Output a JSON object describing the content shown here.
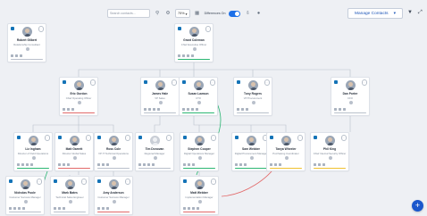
{
  "toolbar": {
    "search_placeholder": "Search contacts...",
    "zoom_value": "75%",
    "diff_label": "Differences On",
    "manage_label": "Manage Contacts",
    "icons": [
      "search-icon",
      "settings-icon",
      "chevron-down-icon",
      "grid-icon",
      "download-icon",
      "filter-icon",
      "expand-icon",
      "plus-icon"
    ]
  },
  "colors": {
    "accent": "#1c6fe8",
    "connector": "#b9c0cb",
    "green_link": "#2bb673",
    "red_link": "#e26a6a",
    "bars": [
      "#2bb673",
      "#f0c12f",
      "#e26a6a",
      "#1c6fe8"
    ]
  },
  "cards": [
    {
      "name": "Grant Coleman",
      "title": "Chief Executive Officer",
      "bar": "#2bb673"
    },
    {
      "name": "Robert Gilbert",
      "title": "Relationship Consultant",
      "bar": "#b9c0cb"
    },
    {
      "name": "Eric Gordon",
      "title": "Chief Operating Officer",
      "bar": "#e26a6a"
    },
    {
      "name": "James Hale",
      "title": "VP Sales",
      "bar": "#b9c0cb"
    },
    {
      "name": "Susan Lawson",
      "title": "CTO",
      "bar": "#2bb673"
    },
    {
      "name": "Tony Rogers",
      "title": "VP Procurement",
      "bar": "#b9c0cb"
    },
    {
      "name": "Dan Porter",
      "title": "CFO",
      "bar": "#b9c0cb"
    },
    {
      "name": "Liz Ingham",
      "title": "Director of Field Operations",
      "bar": "#2bb673"
    },
    {
      "name": "Matt Garrett",
      "title": "Director Global Sales",
      "bar": "#e26a6a"
    },
    {
      "name": "Ross Cole",
      "title": "VP IT Technical Operations",
      "bar": "#b9c0cb"
    },
    {
      "name": "Tim Donovan",
      "title": "Regional Manager",
      "bar": "#b9c0cb"
    },
    {
      "name": "Stephen Cooper",
      "title": "Digital Operations Manager",
      "bar": "#2bb673"
    },
    {
      "name": "Sam Webber",
      "title": "Digital Procurement Manager",
      "bar": "#2bb673"
    },
    {
      "name": "Tanya Wheeler",
      "title": "Purchasing Coordinator",
      "bar": "#f0c12f"
    },
    {
      "name": "Phil King",
      "title": "Chief Internal Security Officer",
      "bar": "#f0c12f"
    },
    {
      "name": "Nicholas Poole",
      "title": "Customer Success Manager",
      "bar": "#b9c0cb"
    },
    {
      "name": "Mark Bates",
      "title": "Technical Sales Engineer",
      "bar": "#b9c0cb"
    },
    {
      "name": "Amy Anderson",
      "title": "Customer Success Manager",
      "bar": "#e26a6a"
    },
    {
      "name": "Matt Webber",
      "title": "Implementation Manager",
      "bar": "#e26a6a"
    }
  ],
  "fab_label": "+"
}
